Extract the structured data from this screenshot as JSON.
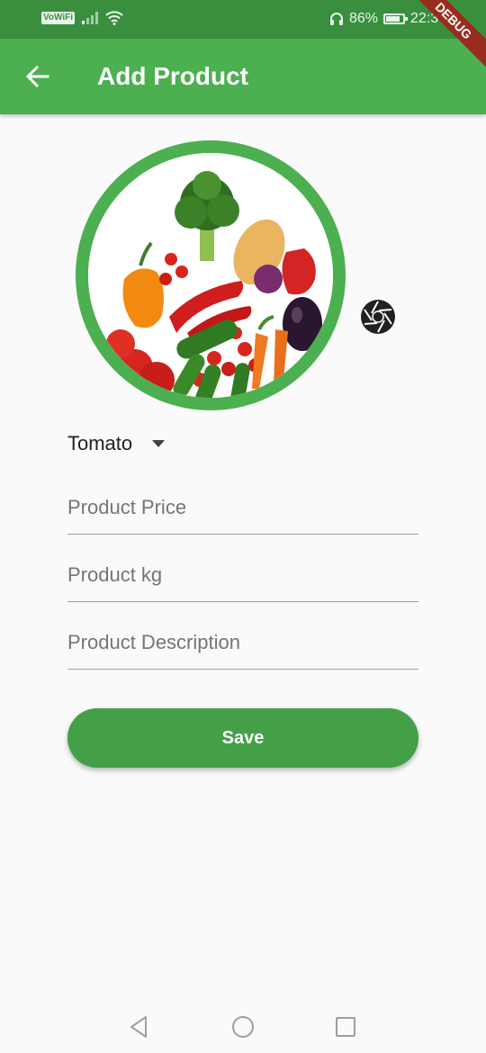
{
  "status_bar": {
    "network_label": "VoWiFi",
    "battery_percent": "86%",
    "battery_level": 0.86,
    "time": "22:3"
  },
  "debug_banner": "DEBUG",
  "app_bar": {
    "title": "Add Product",
    "back_icon": "arrow-left-icon"
  },
  "product_image": {
    "ring_color": "#4caf50",
    "camera_icon": "camera-shutter-icon"
  },
  "product_dropdown": {
    "selected": "Tomato",
    "icon": "dropdown-arrow-icon"
  },
  "form": {
    "price_placeholder": "Product Price",
    "kg_placeholder": "Product kg",
    "description_placeholder": "Product Description"
  },
  "save_button": {
    "label": "Save",
    "color": "#43a047"
  },
  "nav_bar": {
    "back_icon": "triangle-back-icon",
    "home_icon": "circle-home-icon",
    "recents_icon": "square-recents-icon"
  },
  "colors": {
    "primary": "#4caf50",
    "status_bar": "#3a8f3e"
  }
}
